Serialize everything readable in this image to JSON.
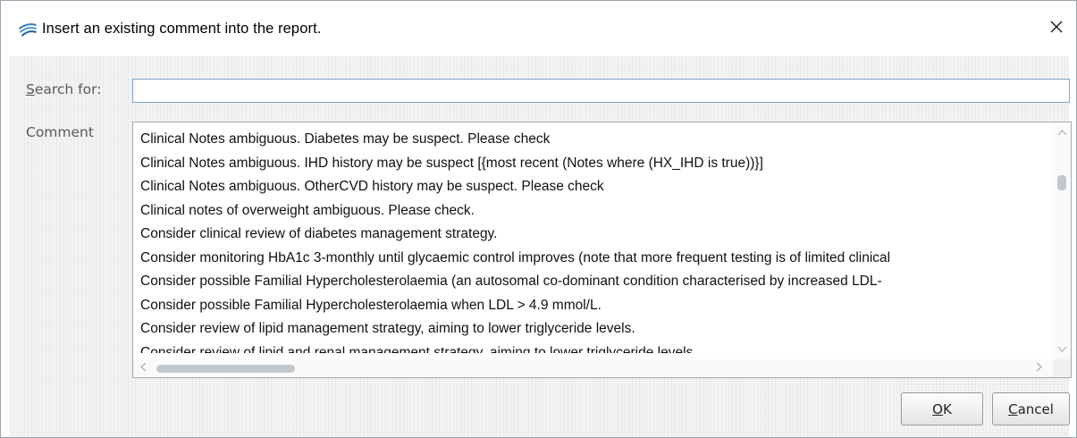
{
  "window": {
    "title": "Insert an existing comment into the report."
  },
  "search": {
    "label_mnemonic": "S",
    "label_rest": "earch for:",
    "value": "",
    "placeholder": ""
  },
  "comment": {
    "label": "Comment",
    "items": [
      "Clinical Notes ambiguous. Diabetes may be suspect. Please check",
      "Clinical Notes ambiguous. IHD history may be suspect [{most recent (Notes where (HX_IHD is true))}]",
      "Clinical Notes ambiguous. OtherCVD history may be suspect. Please check",
      "Clinical notes of overweight ambiguous. Please check.",
      "Consider clinical review of diabetes management strategy.",
      "Consider monitoring HbA1c 3-monthly until glycaemic control improves (note that more frequent testing is of limited clinical",
      "Consider possible Familial Hypercholesterolaemia (an autosomal co-dominant condition characterised by increased LDL-",
      "Consider possible Familial Hypercholesterolaemia when LDL > 4.9 mmol/L.",
      "Consider review of lipid management strategy, aiming to lower triglyceride levels.",
      "Consider review of lipid and renal management strategy, aiming to lower triglyceride levels."
    ]
  },
  "buttons": {
    "ok_mnemonic": "O",
    "ok_rest": "K",
    "cancel_mnemonic": "C",
    "cancel_rest": "ancel"
  },
  "icons": {
    "app": "app-logo-icon",
    "close": "close-icon",
    "scroll_up": "chevron-up-icon",
    "scroll_down": "chevron-down-icon",
    "scroll_left": "chevron-left-icon",
    "scroll_right": "chevron-right-icon"
  },
  "colors": {
    "focus_border": "#7ea6cf",
    "logo_blue": "#2a7fc4"
  }
}
